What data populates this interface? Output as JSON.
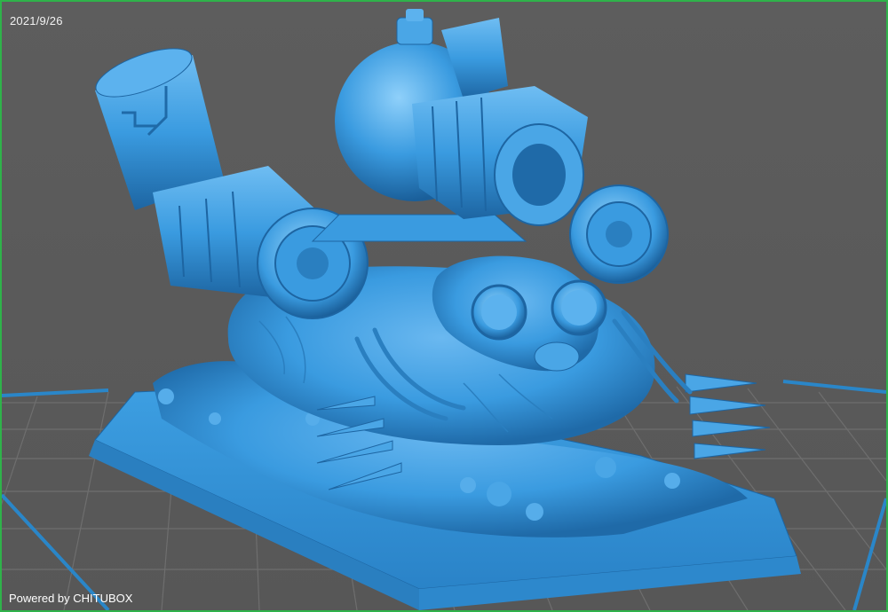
{
  "viewer": {
    "date": "2021/9/26",
    "footer": "Powered by CHITUBOX"
  },
  "colors": {
    "background": "#5a5a5a",
    "frame": "#2fb34a",
    "grid": "#6f6f6f",
    "platform_border": "#2a86c8",
    "model_main": "#3a9be0",
    "model_shadow": "#1f6aa8",
    "model_highlight": "#7cc4f4"
  },
  "scene": {
    "model_icon": "steampunk-mole-miniature-icon",
    "grid_icon": "build-plate-grid-icon"
  }
}
